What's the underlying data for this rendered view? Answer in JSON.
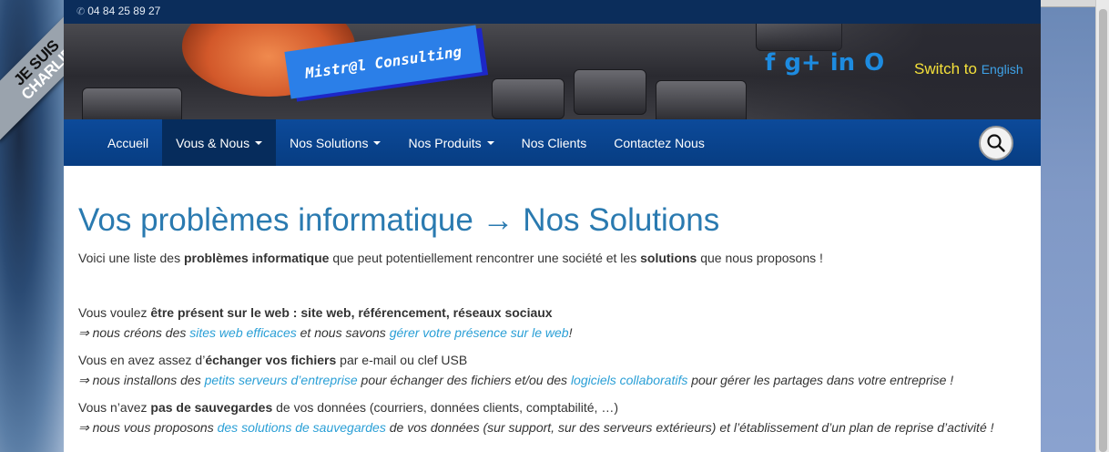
{
  "ribbon": {
    "line1": "JE SUIS",
    "line2": "CHARLIE"
  },
  "topbar": {
    "phone": "04 84 25 89 27"
  },
  "header": {
    "logo_text": "Mistr@l Consulting",
    "social": [
      "f",
      "g+",
      "in",
      "O"
    ],
    "switch_text": "Switch to",
    "switch_link": "English"
  },
  "nav": {
    "items": [
      {
        "label": "Accueil"
      },
      {
        "label": "Vous & Nous"
      },
      {
        "label": "Nos Solutions"
      },
      {
        "label": "Nos Produits"
      },
      {
        "label": "Nos Clients"
      },
      {
        "label": "Contactez Nous"
      }
    ]
  },
  "content": {
    "title": "Vos problèmes informatique → Nos Solutions",
    "intro": {
      "t1": "Voici une liste des ",
      "b1": "problèmes informatique",
      "t2": " que peut potentiellement rencontrer une société et les ",
      "b2": "solutions",
      "t3": " que nous proposons !"
    },
    "block1": {
      "q1": "Vous voulez ",
      "qb": "être présent sur le web : site web, référencement, réseaux sociaux",
      "a1": "⇒ nous créons des ",
      "l1": "sites web efficaces",
      "a2": " et nous savons ",
      "l2": "gérer votre présence sur le web",
      "a3": "!"
    },
    "block2": {
      "q1": "Vous en avez assez d’",
      "qb": "échanger vos fichiers",
      "q2": " par e-mail ou clef USB",
      "a1": "⇒ nous installons des ",
      "l1": "petits serveurs d’entreprise",
      "a2": " pour échanger des fichiers et/ou des ",
      "l2": "logiciels collaboratifs",
      "a3": " pour gérer les partages dans votre entreprise !"
    },
    "block3": {
      "q1": "Vous n’avez ",
      "qb": "pas de sauvegardes",
      "q2": " de vos données (courriers, données clients, comptabilité, …)",
      "a1": "⇒ nous vous proposons ",
      "l1": "des solutions de sauvegardes",
      "a2": " de vos données (sur support, sur des serveurs extérieurs) et l’établissement d’un plan de reprise d’activité !"
    }
  }
}
